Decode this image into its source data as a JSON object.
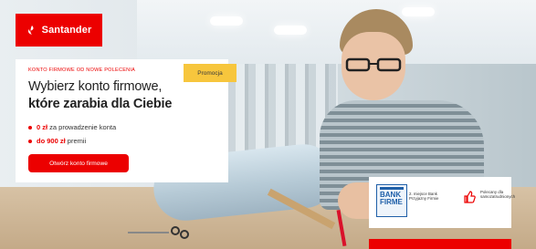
{
  "brand": {
    "name": "Santander",
    "color": "#ec0000",
    "icon": "santander-flame-icon"
  },
  "promo": {
    "eyebrow": "KONTO FIRMOWE OD NOWE POLECENIA",
    "badge": "Promocja",
    "title_line1": "Wybierz konto firmowe,",
    "title_line2": "które zarabia dla Ciebie",
    "bullets": [
      {
        "strong": "0 zł",
        "rest": " za prowadzenie konta"
      },
      {
        "strong": "do 900 zł",
        "rest": " premii"
      }
    ],
    "cta_label": "Otwórz konto firmowe"
  },
  "award": {
    "logo_text": "BANK FIRME",
    "logo_icon": "bank-przyjazny-firmie-logo",
    "text1": "2. miejsce Bank Przyjazny Firmie",
    "text2": "Polecany dla samozatrudnionych",
    "thumb_icon": "thumbs-up-icon"
  }
}
